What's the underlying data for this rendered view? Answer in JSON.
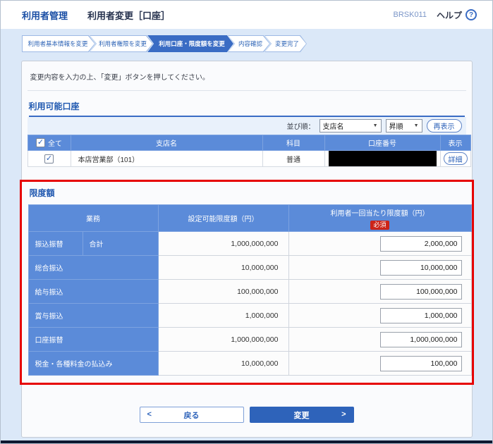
{
  "header": {
    "app_title": "利用者管理",
    "page_title": "利用者変更［口座］",
    "screen_code": "BRSK011",
    "help_label": "ヘルプ"
  },
  "icons": {
    "help": "?",
    "check": "✓",
    "caret_down": "▼",
    "chevron_left": "<",
    "chevron_right": ">"
  },
  "steps": [
    {
      "label": "利用者基本情報を変更",
      "state": "inactive"
    },
    {
      "label": "利用者権限を変更",
      "state": "inactive"
    },
    {
      "label": "利用口座・限度額を変更",
      "state": "active"
    },
    {
      "label": "内容確認",
      "state": "inactive"
    },
    {
      "label": "変更完了",
      "state": "inactive"
    }
  ],
  "instruction": "変更内容を入力の上、「変更」ボタンを押してください。",
  "accounts_section": {
    "title": "利用可能口座",
    "sort": {
      "label": "並び順：",
      "sort_key": "支店名",
      "sort_order": "昇順",
      "refresh_label": "再表示"
    },
    "table": {
      "headers": {
        "all": "全て",
        "branch": "支店名",
        "type": "科目",
        "number": "口座番号",
        "display": "表示"
      },
      "rows": [
        {
          "checked": true,
          "branch": "本店営業部（101）",
          "type": "普通",
          "number": "",
          "detail_label": "詳細"
        }
      ]
    }
  },
  "limits_section": {
    "title": "限度額",
    "table": {
      "headers": {
        "business": "業務",
        "settable": "設定可能限度額（円）",
        "per_use": "利用者一回当たり限度額（円）",
        "required_badge": "必須"
      },
      "rows": [
        {
          "category": "振込振替",
          "sub": "合計",
          "max": "1,000,000,000",
          "value": "2,000,000"
        },
        {
          "category": "総合振込",
          "max": "10,000,000",
          "value": "10,000,000"
        },
        {
          "category": "給与振込",
          "max": "100,000,000",
          "value": "100,000,000"
        },
        {
          "category": "賞与振込",
          "max": "1,000,000",
          "value": "1,000,000"
        },
        {
          "category": "口座振替",
          "max": "1,000,000,000",
          "value": "1,000,000,000"
        },
        {
          "category": "税金・各種料金の払込み",
          "max": "10,000,000",
          "value": "100,000"
        }
      ]
    }
  },
  "actions": {
    "back_label": "戻る",
    "submit_label": "変更"
  },
  "colors": {
    "accent_blue": "#2e63ba",
    "table_header_blue": "#5b8bd9",
    "active_step_blue": "#3a6cc4",
    "highlight_red": "#e60000",
    "required_badge_red": "#cc2418",
    "page_background": "#dbe8f8"
  }
}
